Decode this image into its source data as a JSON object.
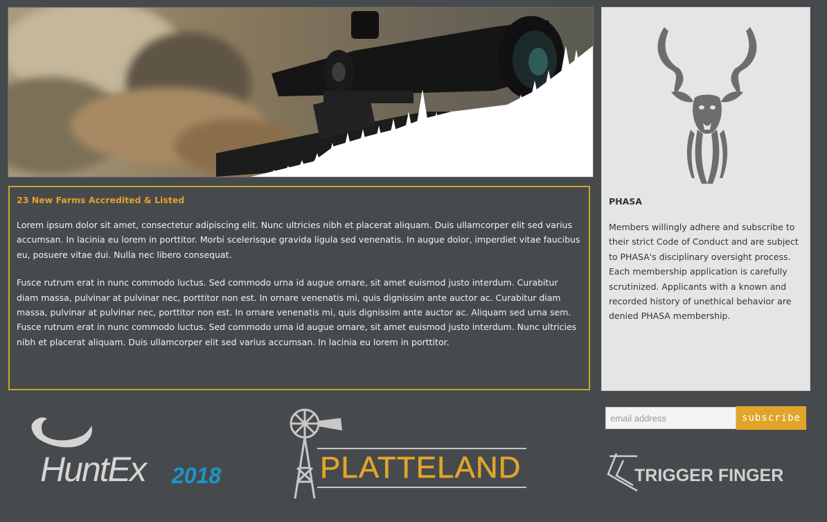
{
  "hero": {
    "image": "hunter-with-rifle-scope-and-pine-silhouettes"
  },
  "article": {
    "title": "23 New Farms Accredited & Listed",
    "paragraph_1": "Lorem ipsum dolor sit amet, consectetur adipiscing elit. Nunc ultricies nibh et placerat aliquam. Duis ullamcorper elit sed varius accumsan. In lacinia eu lorem in porttitor. Morbi scelerisque gravida ligula sed venenatis. In augue dolor, imperdiet vitae faucibus eu, posuere vitae dui. Nulla nec libero consequat.",
    "paragraph_2": "Fusce rutrum erat in nunc commodo luctus. Sed commodo urna id augue ornare, sit amet euismod justo interdum. Curabitur diam massa, pulvinar at pulvinar nec, porttitor non est. In ornare venenatis mi, quis dignissim ante auctor ac. Curabitur diam massa, pulvinar at pulvinar nec, porttitor non est. In ornare venenatis mi, quis dignissim ante auctor ac. Aliquam sed urna sem. Fusce rutrum erat in nunc commodo luctus. Sed commodo urna id augue ornare, sit amet euismod justo interdum. Nunc ultricies nibh et placerat aliquam. Duis ullamcorper elit sed varius accumsan. In lacinia eu lorem in porttitor."
  },
  "sidebar": {
    "logo_icon": "kudu-head-icon",
    "title": "PHASA",
    "body": "Members willingly adhere and subscribe to their strict Code of Conduct and are subject to PHASA's disciplinary oversight process. Each membership application is carefully scrutinized. Applicants with a known and recorded history of unethical behavior are denied PHASA membership."
  },
  "subscribe": {
    "placeholder": "email address",
    "button_label": "subscribe"
  },
  "sponsors": {
    "huntex_name": "HuntEx",
    "huntex_year": "2018",
    "platteland_name": "PLATTELAND",
    "trigger_finger_name": "TRIGGER FINGER"
  },
  "colors": {
    "background": "#474a4c",
    "accent_gold": "#e0a52a",
    "article_border": "#c9a82c",
    "huntex_blue": "#1a96c8"
  }
}
